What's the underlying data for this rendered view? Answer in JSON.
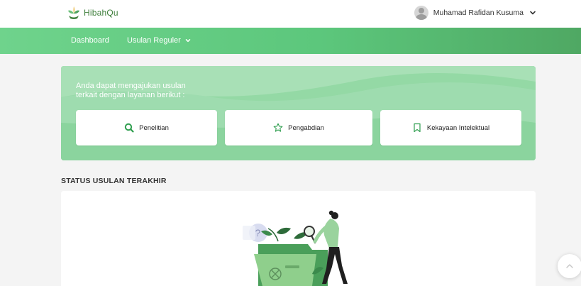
{
  "app": {
    "name": "HibahQu",
    "logo_icon": "plant-sprout-icon",
    "accent": "#5cc77c"
  },
  "user": {
    "name": "Muhamad Rafidan Kusuma",
    "avatar_icon": "user-avatar-icon"
  },
  "nav": {
    "items": [
      {
        "label": "Dashboard"
      },
      {
        "label": "Usulan Reguler",
        "icon": "chevron-down-icon"
      }
    ]
  },
  "hero": {
    "line1": "Anda dapat mengajukan usulan",
    "line2": "terkait dengan layanan berikut :",
    "cards": [
      {
        "label": "Penelitian",
        "icon": "search-icon"
      },
      {
        "label": "Pengabdian",
        "icon": "star-icon"
      },
      {
        "label": "Kekayaan Intelektual",
        "icon": "bookmark-icon"
      }
    ]
  },
  "status": {
    "title": "STATUS USULAN TERAKHIR",
    "illustration": "empty-folder-search-illustration"
  },
  "fab": {
    "icon": "chevron-up-icon"
  }
}
